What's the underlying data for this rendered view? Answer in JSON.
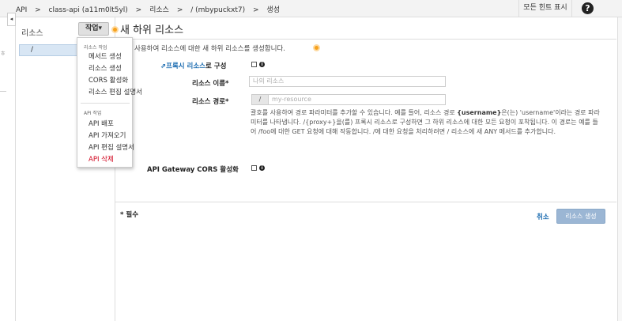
{
  "breadcrumb": {
    "items": [
      "API",
      ">",
      "class-api (a11m0lt5yl)",
      ">",
      "리소스",
      ">",
      "/ (mbypuckxt7)",
      ">",
      "생성"
    ]
  },
  "header": {
    "hint_toggle": "모든 힌트 표시",
    "help_icon": "?"
  },
  "resources_panel": {
    "title": "리소스",
    "collapse_icon": "◂",
    "actions_button": "작업▾",
    "root_path": "/"
  },
  "actions_menu": {
    "resource_group": "리소스 작업",
    "resource_items": [
      "메서드 생성",
      "리소스 생성",
      "CORS 활성화",
      "리소스 편집 설명서"
    ],
    "api_group": "API 작업",
    "api_items": [
      "API 배포",
      "API 가져오기",
      "API 편집 설명서",
      "API 삭제"
    ]
  },
  "form": {
    "title": "새 하위 리소스",
    "intro": "사용하여 리소스에 대한 새 하위 리소스를 생성합니다.",
    "proxy_link": "프록시 리소스",
    "proxy_suffix": "로 구성",
    "name_label": "리소스 이름*",
    "name_placeholder": "나의 리소스",
    "path_label": "리소스 경로*",
    "path_prefix": "/",
    "path_placeholder": "my-resource",
    "help_parts": {
      "a": "괄호를 사용하여 경로 파라미터를 추가할 수 있습니다. 예를 들어, 리소스 경로 ",
      "b": "{username}",
      "c": "은(는) 'username'이라는 경로 파라미터를 나타냅니다. /{proxy+}을(를) 프록시 리소스로 구성하면 그 하위 리소스에 대한 모든 요청이 포착됩니다. 이 경로는 예를 들어 /foo에 대한 GET 요청에 대해 작동합니다. /에 대한 요청을 처리하려면 / 리소스에 새 ANY 메서드를 추가합니다."
    },
    "cors_label": "API Gateway CORS 활성화",
    "info_icon": "i",
    "required_note": "* 필수",
    "cancel": "취소",
    "create": "리소스 생성"
  },
  "colors": {
    "accent_link": "#1a6bb0",
    "delete_red": "#d0021b",
    "create_button": "#9bb6d4",
    "selected_row": "#d8e6f4",
    "hint_dot": "#f7a21d"
  }
}
